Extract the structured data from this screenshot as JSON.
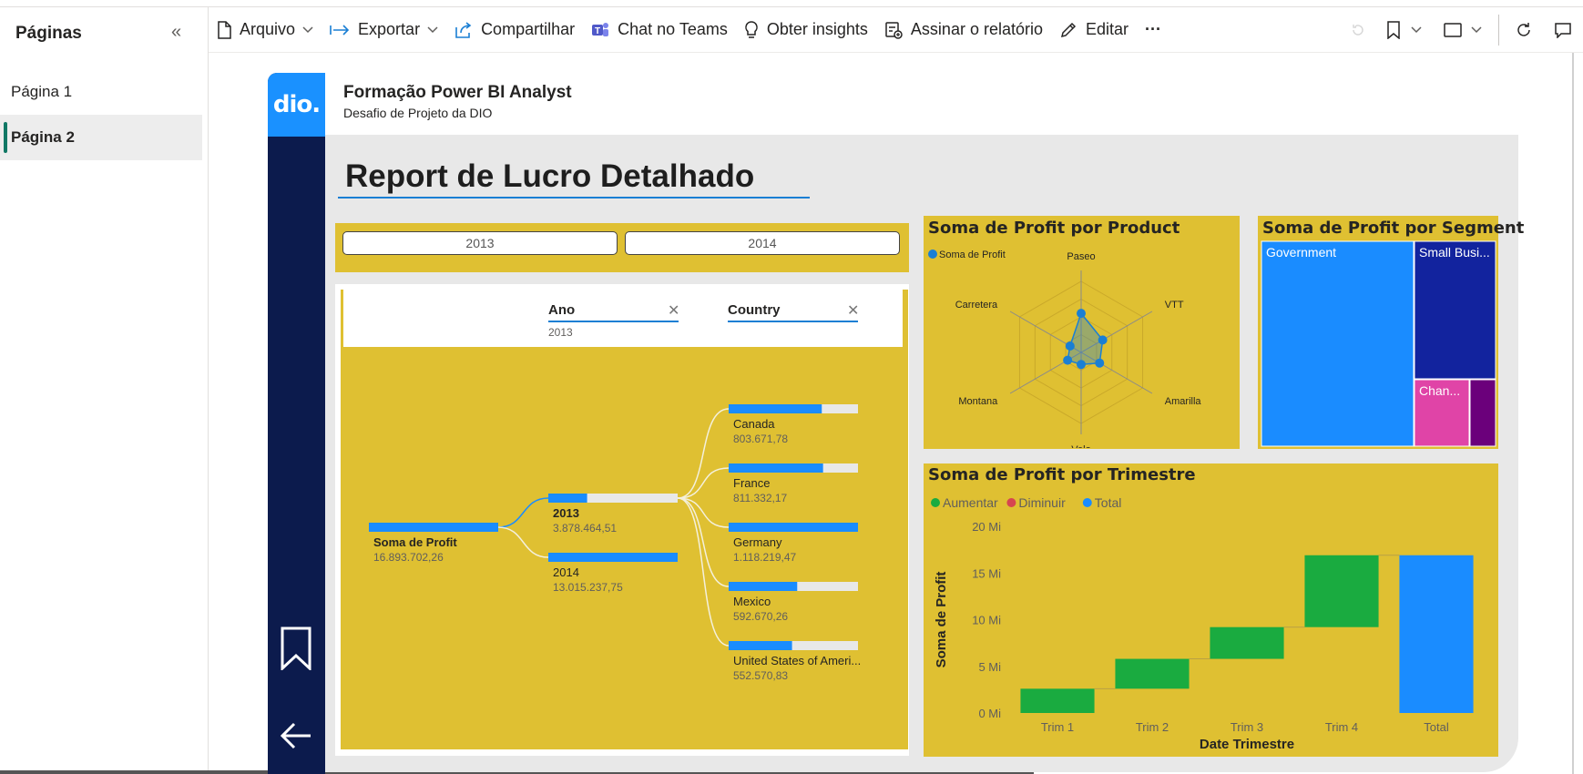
{
  "pages_pane": {
    "title": "Páginas",
    "pages": [
      {
        "label": "Página 1",
        "active": false
      },
      {
        "label": "Página 2",
        "active": true
      }
    ]
  },
  "toolbar": {
    "file": "Arquivo",
    "export": "Exportar",
    "share": "Compartilhar",
    "teams": "Chat no Teams",
    "insights": "Obter insights",
    "subscribe": "Assinar o relatório",
    "edit": "Editar",
    "more": "···"
  },
  "report": {
    "logo": "dio.",
    "header_title": "Formação Power BI Analyst",
    "header_subtitle": "Desafio de Projeto da DIO",
    "main_title": "Report de Lucro Detalhado",
    "year_buttons": [
      "2013",
      "2014"
    ]
  },
  "decomposition": {
    "filters": [
      {
        "label": "Ano",
        "value": "2013"
      },
      {
        "label": "Country",
        "value": ""
      }
    ],
    "root": {
      "label": "Soma de Profit",
      "value": "16.893.702,26"
    },
    "level1": [
      {
        "label": "2013",
        "value": "3.878.464,51",
        "fill": 0.3,
        "selected": true
      },
      {
        "label": "2014",
        "value": "13.015.237,75",
        "fill": 1.0,
        "selected": false
      }
    ],
    "level2": [
      {
        "label": "Canada",
        "value": "803.671,78",
        "fill": 0.72
      },
      {
        "label": "France",
        "value": "811.332,17",
        "fill": 0.73
      },
      {
        "label": "Germany",
        "value": "1.118.219,47",
        "fill": 1.0
      },
      {
        "label": "Mexico",
        "value": "592.670,26",
        "fill": 0.53
      },
      {
        "label": "United States of Ameri...",
        "value": "552.570,83",
        "fill": 0.49
      }
    ]
  },
  "chart_data": [
    {
      "type": "radar",
      "title": "Soma de Profit por Product",
      "legend": "Soma de Profit",
      "categories": [
        "Paseo",
        "VTT",
        "Amarilla",
        "Velo",
        "Montana",
        "Carretera"
      ],
      "values": [
        0.55,
        0.35,
        0.3,
        0.17,
        0.22,
        0.18
      ],
      "color": "#1a7fd4"
    },
    {
      "type": "treemap",
      "title": "Soma de Profit por Segment",
      "labels": [
        "Government",
        "Small Busi...",
        "Chan...",
        ""
      ],
      "colors": [
        "#1a8cff",
        "#12239e",
        "#e044a7",
        "#6b007b"
      ]
    },
    {
      "type": "waterfall",
      "title": "Soma de Profit por Trimestre",
      "legend": [
        "Aumentar",
        "Diminuir",
        "Total"
      ],
      "legend_colors": [
        "#1aab40",
        "#d64550",
        "#1a8cff"
      ],
      "categories": [
        "Trim 1",
        "Trim 2",
        "Trim 3",
        "Trim 4",
        "Total"
      ],
      "ranges": [
        [
          0,
          2.6
        ],
        [
          2.6,
          5.8
        ],
        [
          5.8,
          9.2
        ],
        [
          9.2,
          16.9
        ],
        [
          0,
          16.9
        ]
      ],
      "kinds": [
        "increase",
        "increase",
        "increase",
        "increase",
        "total"
      ],
      "y_ticks": [
        "0 Mi",
        "5 Mi",
        "10 Mi",
        "15 Mi",
        "20 Mi"
      ],
      "ylim": [
        0,
        20
      ],
      "xlabel": "Date Trimestre",
      "ylabel": "Soma de Profit"
    }
  ]
}
